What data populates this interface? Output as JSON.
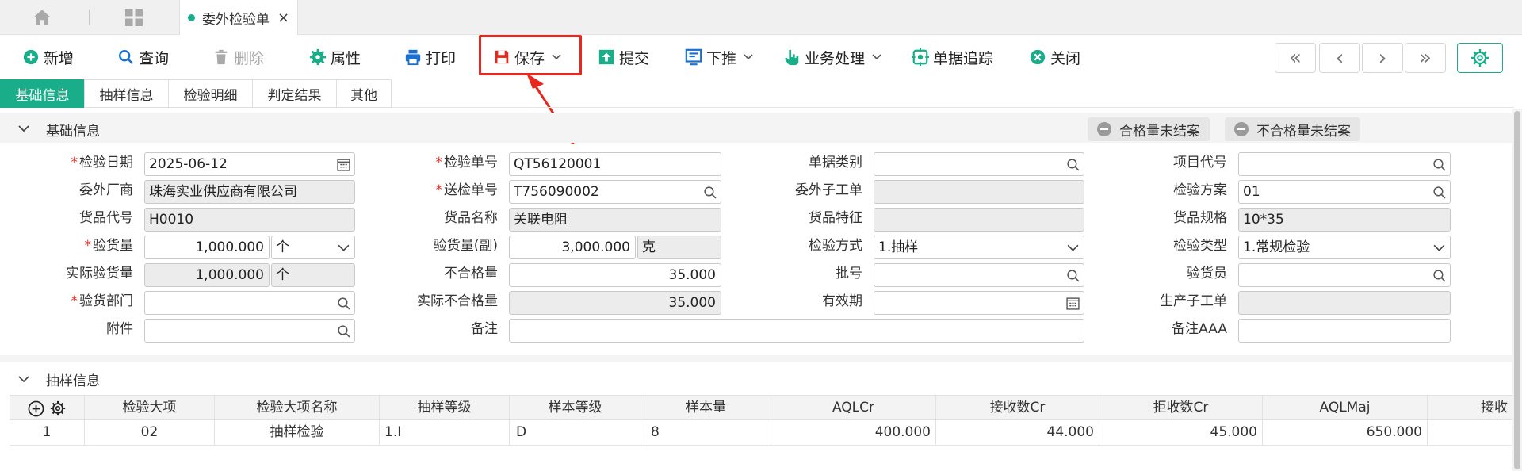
{
  "tabbar": {
    "active_tab": "委外检验单",
    "close": "×"
  },
  "toolbar": {
    "buttons": [
      {
        "label": "新增"
      },
      {
        "label": "查询"
      },
      {
        "label": "删除"
      },
      {
        "label": "属性"
      },
      {
        "label": "打印"
      },
      {
        "label": "保存"
      },
      {
        "label": "提交"
      },
      {
        "label": "下推"
      },
      {
        "label": "业务处理"
      },
      {
        "label": "单据追踪"
      },
      {
        "label": "关闭"
      }
    ],
    "nav": [
      "«",
      "‹",
      "›",
      "»"
    ]
  },
  "subtabs": [
    "基础信息",
    "抽样信息",
    "检验明细",
    "判定结果",
    "其他"
  ],
  "section_basic": {
    "title": "基础信息",
    "pill_1": "合格量未结案",
    "pill_2": "不合格量未结案"
  },
  "form": {
    "inspect_date": {
      "label": "检验日期",
      "value": "2025-06-12"
    },
    "supplier": {
      "label": "委外厂商",
      "value": "珠海实业供应商有限公司"
    },
    "item_code": {
      "label": "货品代号",
      "value": "H0010"
    },
    "inspect_qty": {
      "label": "验货量",
      "value": "1,000.000",
      "unit": "个"
    },
    "actual_qty": {
      "label": "实际验货量",
      "value": "1,000.000",
      "unit": "个"
    },
    "dept": {
      "label": "验货部门",
      "value": ""
    },
    "attach": {
      "label": "附件",
      "value": ""
    },
    "inspect_no": {
      "label": "检验单号",
      "value": "QT56120001"
    },
    "send_no": {
      "label": "送检单号",
      "value": "T756090002"
    },
    "item_name": {
      "label": "货品名称",
      "value": "关联电阻"
    },
    "inspect_qty2": {
      "label": "验货量(副)",
      "value": "3,000.000",
      "unit": "克"
    },
    "ng_qty": {
      "label": "不合格量",
      "value": "35.000"
    },
    "actual_ng_qty": {
      "label": "实际不合格量",
      "value": "35.000"
    },
    "remark": {
      "label": "备注",
      "value": ""
    },
    "doc_type": {
      "label": "单据类别",
      "value": ""
    },
    "sub_order": {
      "label": "委外子工单",
      "value": ""
    },
    "item_feature": {
      "label": "货品特征",
      "value": ""
    },
    "method": {
      "label": "检验方式",
      "value": "1.抽样"
    },
    "batch": {
      "label": "批号",
      "value": ""
    },
    "expiry": {
      "label": "有效期",
      "value": ""
    },
    "project": {
      "label": "项目代号",
      "value": ""
    },
    "scheme": {
      "label": "检验方案",
      "value": "01"
    },
    "spec": {
      "label": "货品规格",
      "value": "10*35"
    },
    "inspect_type": {
      "label": "检验类型",
      "value": "1.常规检验"
    },
    "inspector": {
      "label": "验货员",
      "value": ""
    },
    "prod_order": {
      "label": "生产子工单",
      "value": ""
    },
    "remark_aaa": {
      "label": "备注AAA",
      "value": ""
    }
  },
  "section_sampling": {
    "title": "抽样信息"
  },
  "table": {
    "headers": [
      "检验大项",
      "检验大项名称",
      "抽样等级",
      "样本等级",
      "样本量",
      "AQLCr",
      "接收数Cr",
      "拒收数Cr",
      "AQLMaj",
      "接收"
    ],
    "rows": [
      [
        "1",
        "02",
        "抽样检验",
        "1.I",
        "D",
        "8",
        "400.000",
        "44.000",
        "45.000",
        "650.000",
        ""
      ]
    ]
  },
  "colors": {
    "accent": "#1aad8a",
    "highlight": "#e8281f"
  }
}
